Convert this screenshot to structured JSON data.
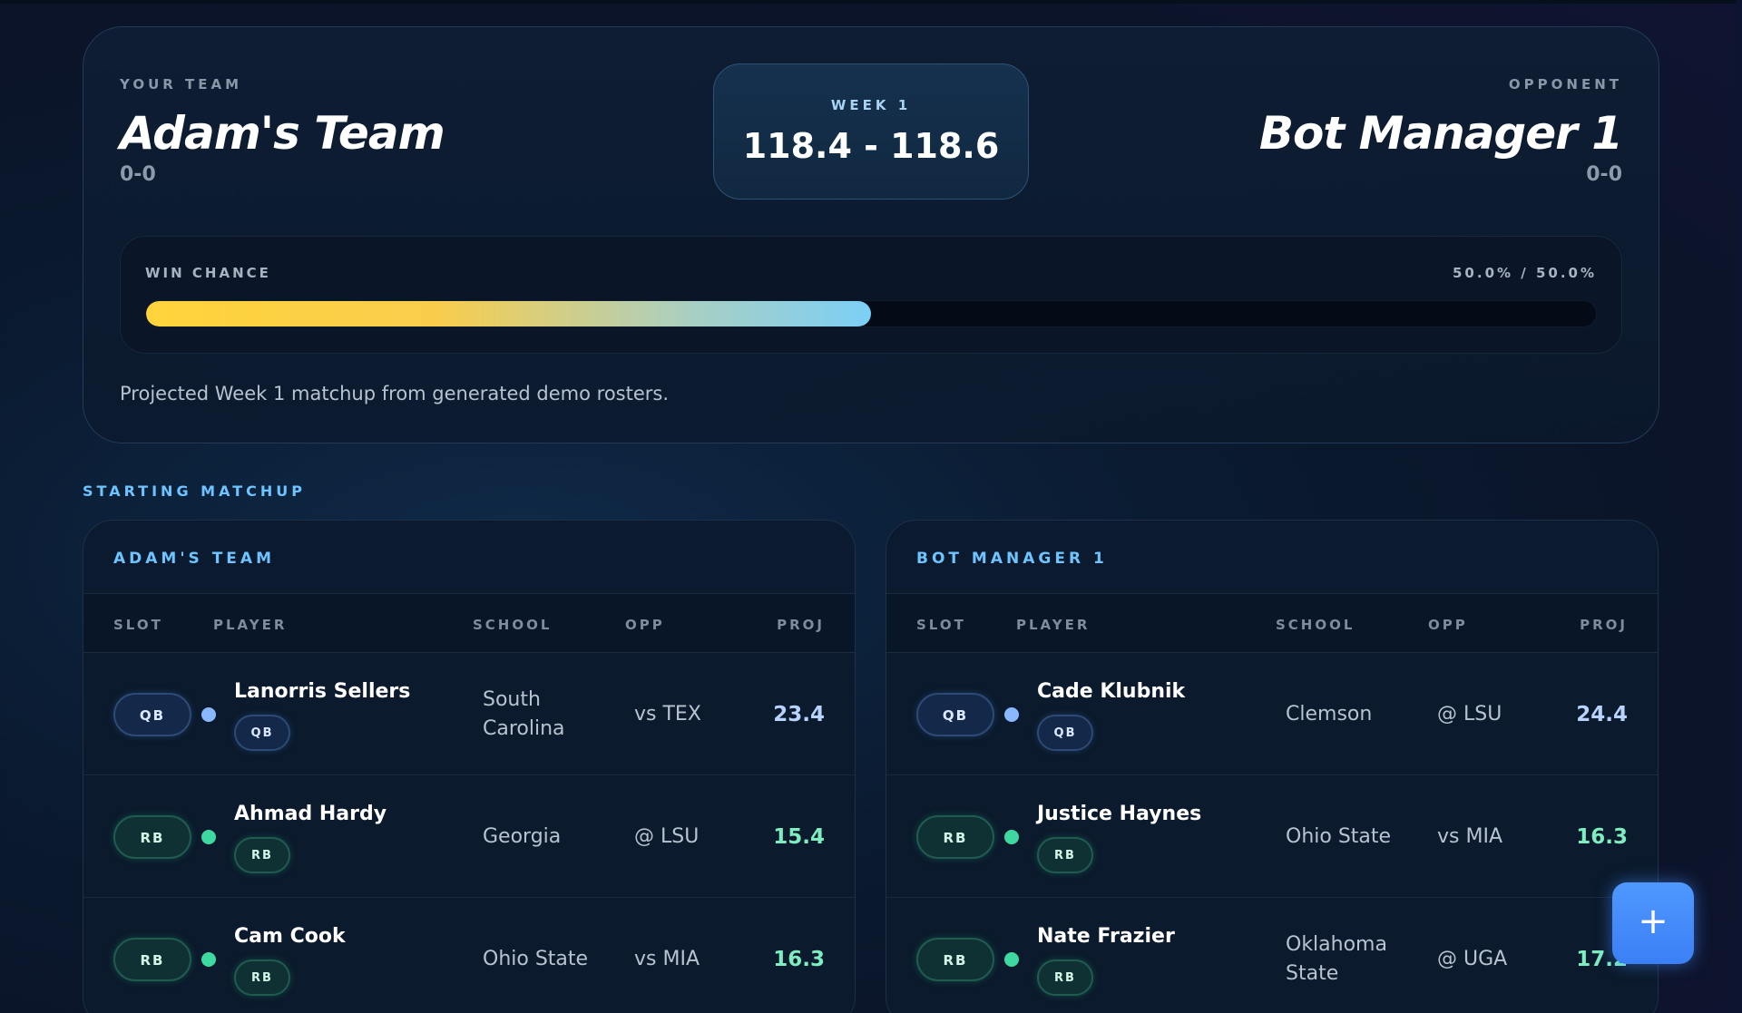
{
  "matchup": {
    "your_team": {
      "eyebrow": "YOUR TEAM",
      "name": "Adam's Team",
      "record": "0-0"
    },
    "opponent": {
      "eyebrow": "OPPONENT",
      "name": "Bot Manager 1",
      "record": "0-0"
    },
    "week_label": "WEEK 1",
    "score": "118.4 - 118.6",
    "win_chance": {
      "label": "WIN CHANCE",
      "value": "50.0% / 50.0%",
      "fill_fraction": 0.5
    },
    "caption": "Projected Week 1 matchup from generated demo rosters."
  },
  "section_title": "STARTING MATCHUP",
  "columns": {
    "slot": "SLOT",
    "player": "PLAYER",
    "school": "SCHOOL",
    "opp": "OPP",
    "proj": "PROJ"
  },
  "rosters": [
    {
      "title": "ADAM'S TEAM",
      "rows": [
        {
          "slot": "QB",
          "name": "Lanorris Sellers",
          "pos": "QB",
          "school": "South Carolina",
          "opp": "vs TEX",
          "proj": "23.4"
        },
        {
          "slot": "RB",
          "name": "Ahmad Hardy",
          "pos": "RB",
          "school": "Georgia",
          "opp": "@ LSU",
          "proj": "15.4"
        },
        {
          "slot": "RB",
          "name": "Cam Cook",
          "pos": "RB",
          "school": "Ohio State",
          "opp": "vs MIA",
          "proj": "16.3"
        }
      ]
    },
    {
      "title": "BOT MANAGER 1",
      "rows": [
        {
          "slot": "QB",
          "name": "Cade Klubnik",
          "pos": "QB",
          "school": "Clemson",
          "opp": "@ LSU",
          "proj": "24.4"
        },
        {
          "slot": "RB",
          "name": "Justice Haynes",
          "pos": "RB",
          "school": "Ohio State",
          "opp": "vs MIA",
          "proj": "16.3"
        },
        {
          "slot": "RB",
          "name": "Nate Frazier",
          "pos": "RB",
          "school": "Oklahoma State",
          "opp": "@ UGA",
          "proj": "17.2"
        }
      ]
    }
  ],
  "fab": {
    "label": "+",
    "icon": "plus-icon"
  },
  "colors": {
    "accent_blue": "#6ec4ff",
    "qb": "#8ab8ff",
    "rb": "#3ed9a0",
    "win_start": "#ffd43b",
    "win_end": "#7ccff6",
    "fab": "#4f98ff"
  }
}
